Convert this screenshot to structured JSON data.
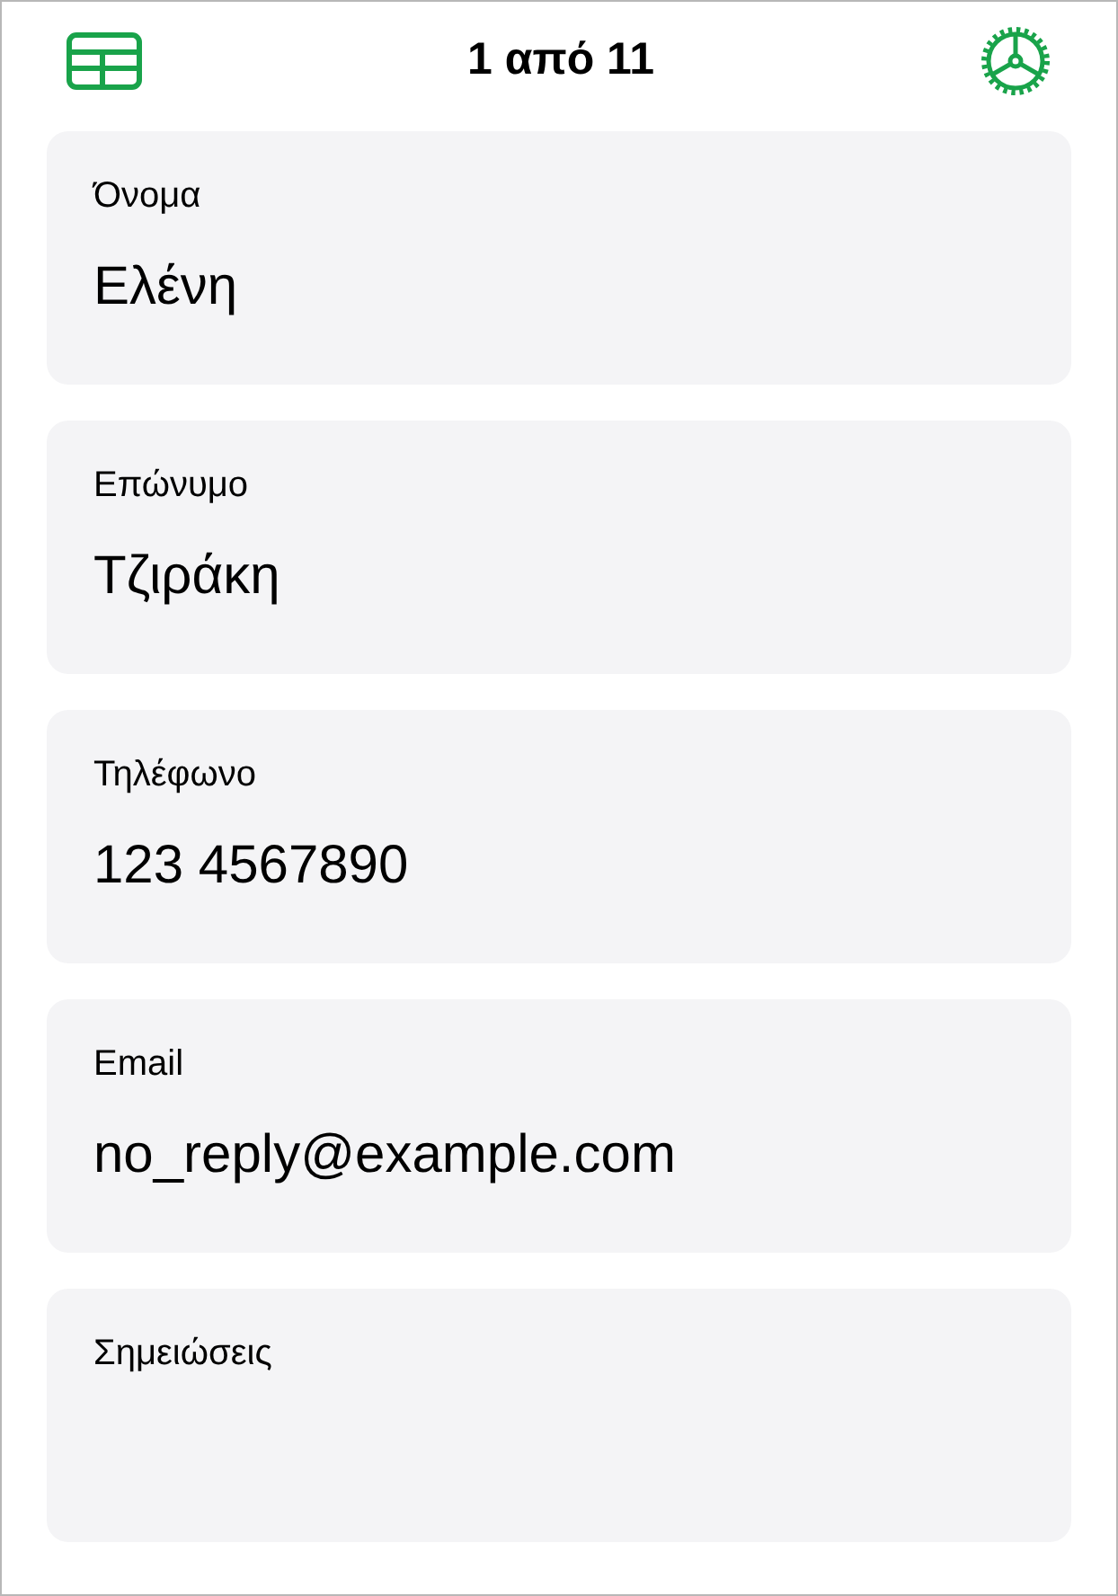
{
  "header": {
    "title": "1 από 11"
  },
  "fields": [
    {
      "label": "Όνομα",
      "value": "Ελένη"
    },
    {
      "label": "Επώνυμο",
      "value": "Τζιράκη"
    },
    {
      "label": "Τηλέφωνο",
      "value": "123 4567890"
    },
    {
      "label": "Email",
      "value": "no_reply@example.com"
    },
    {
      "label": "Σημειώσεις"
    }
  ]
}
